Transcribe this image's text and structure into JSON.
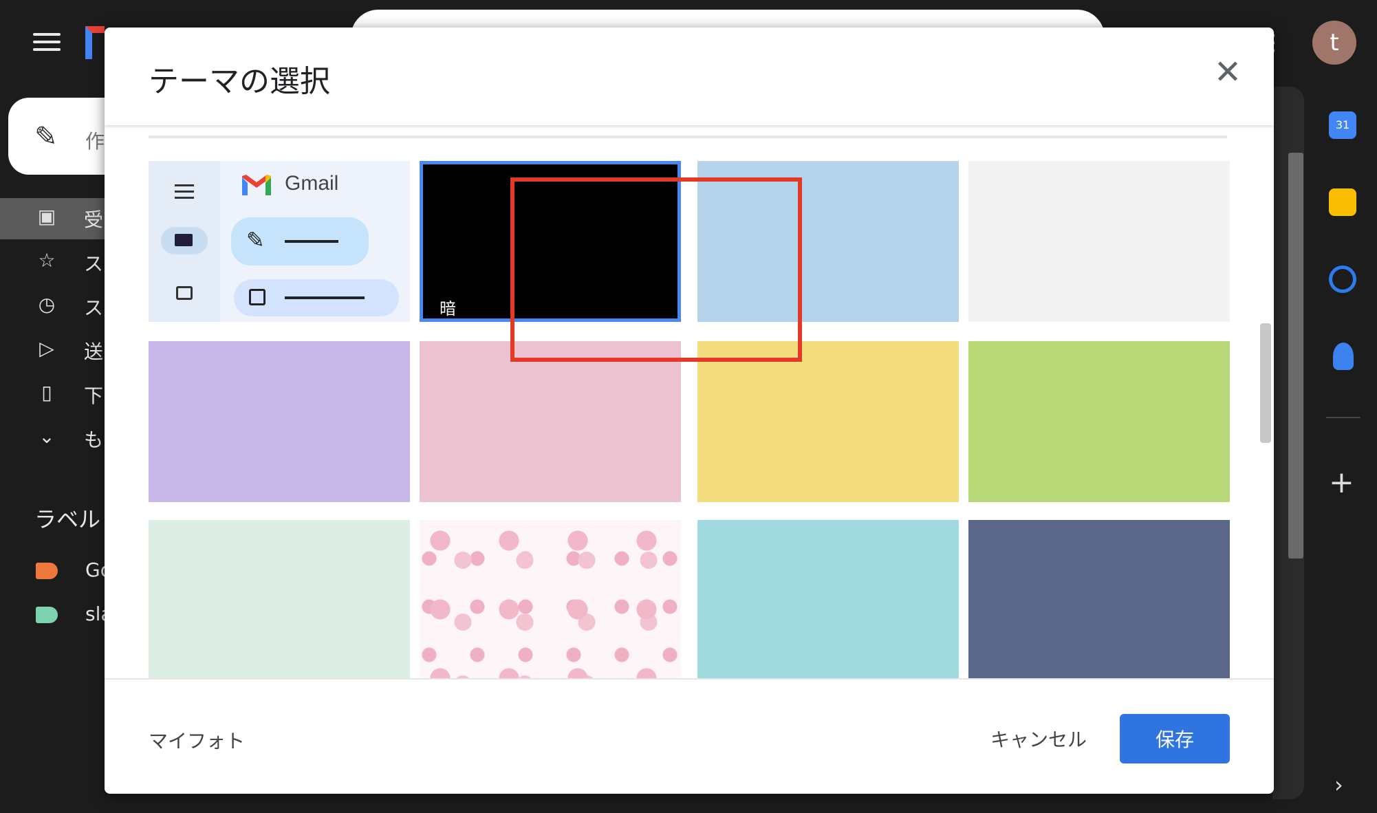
{
  "background": {
    "compose_label": "作",
    "nav": [
      {
        "icon": "inbox-icon",
        "label": "受"
      },
      {
        "icon": "star-icon",
        "label": "ス"
      },
      {
        "icon": "clock-icon",
        "label": "ス"
      },
      {
        "icon": "send-icon",
        "label": "送"
      },
      {
        "icon": "file-icon",
        "label": "下"
      },
      {
        "icon": "chevron-down-icon",
        "label": "も"
      }
    ],
    "labels_title": "ラベル",
    "labels": [
      {
        "name": "Go",
        "color": "#f0783c"
      },
      {
        "name": "sla",
        "color": "#7dd3b0"
      }
    ],
    "avatar_letter": "t",
    "calendar_day": "31"
  },
  "dialog": {
    "title": "テーマの選択",
    "preview_gmail_text": "Gmail",
    "themes": [
      {
        "label": "暗",
        "color": "#000000",
        "selected": true
      },
      {
        "color": "#b6d3ec"
      },
      {
        "color": "#f3f3f3"
      },
      {
        "color": "#c8b8ea"
      },
      {
        "color": "#edc3d1"
      },
      {
        "color": "#f3dc7e"
      },
      {
        "color": "#b8d878"
      },
      {
        "color": "#ddefe4"
      },
      {
        "pattern": "sakura-pattern"
      },
      {
        "color": "#a0dade"
      },
      {
        "color": "#5a6788"
      }
    ],
    "my_photos": "マイフォト",
    "cancel": "キャンセル",
    "save": "保存"
  },
  "colors": {
    "accent_blue": "#2f74e0",
    "highlight_red": "#e43a25"
  }
}
